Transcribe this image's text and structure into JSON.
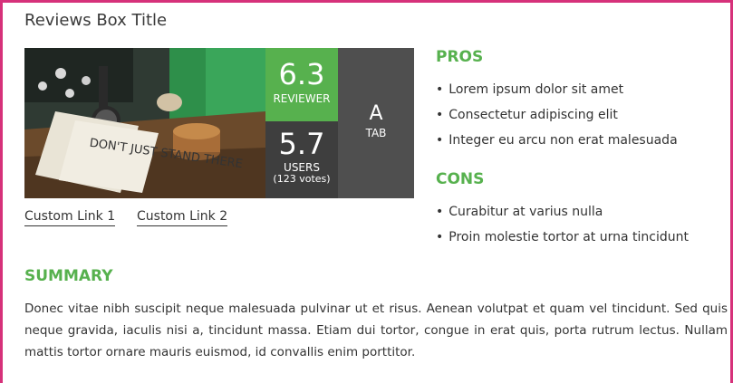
{
  "box": {
    "title": "Reviews Box Title"
  },
  "image": {
    "caption_text": "DON'T JUST STAND THERE"
  },
  "scores": {
    "reviewer_score": "6.3",
    "reviewer_label": "REVIEWER",
    "users_score": "5.7",
    "users_label": "USERS",
    "users_votes": "(123 votes)",
    "tab_grade": "A",
    "tab_label": "TAB"
  },
  "links": [
    "Custom Link 1",
    "Custom Link 2"
  ],
  "pros": {
    "heading": "PROS",
    "items": [
      "Lorem ipsum dolor sit amet",
      "Consectetur adipiscing elit",
      "Integer eu arcu non erat malesuada"
    ]
  },
  "cons": {
    "heading": "CONS",
    "items": [
      "Curabitur at varius nulla",
      "Proin molestie tortor at urna tincidunt"
    ]
  },
  "summary": {
    "heading": "SUMMARY",
    "text": "Donec vitae nibh suscipit neque malesuada pulvinar ut et risus. Aenean volutpat et quam vel tincidunt. Sed quis neque gravida, iaculis nisi a, tincidunt massa. Etiam dui tortor, congue in erat quis, porta rutrum lectus. Nullam mattis tortor ornare mauris euismod, id convallis enim porttitor."
  },
  "colors": {
    "accent": "#57b14e",
    "border": "#d6317a",
    "dark_panel": "#3e3e3e",
    "tab_panel": "#4f4f4f"
  }
}
